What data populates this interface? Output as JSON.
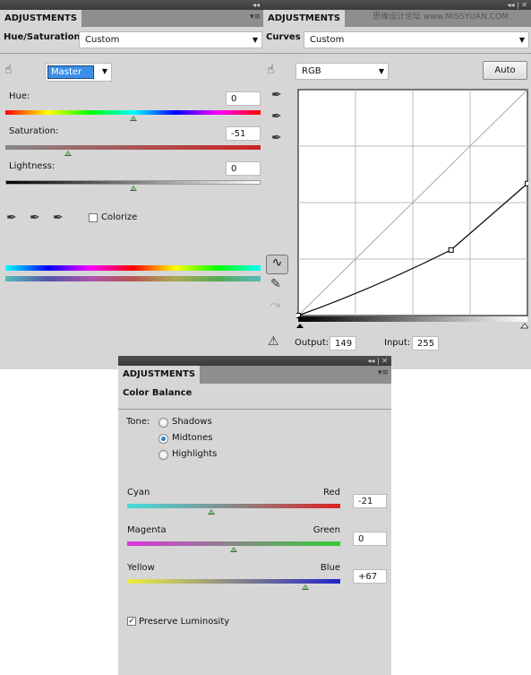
{
  "watermark": "思缘设计论坛 www.MISSYUAN.COM",
  "hue_sat": {
    "tab": "ADJUSTMENTS",
    "title": "Hue/Saturation",
    "preset": "Custom",
    "channel": "Master",
    "hue_label": "Hue:",
    "hue": "0",
    "sat_label": "Saturation:",
    "sat": "-51",
    "light_label": "Lightness:",
    "light": "0",
    "colorize": "Colorize",
    "colorize_checked": false
  },
  "curves": {
    "tab": "ADJUSTMENTS",
    "title": "Curves",
    "preset": "Custom",
    "channel": "RGB",
    "auto": "Auto",
    "output_label": "Output:",
    "output": "149",
    "input_label": "Input:",
    "input": "255",
    "points": [
      [
        0,
        0
      ],
      [
        170,
        74
      ],
      [
        255,
        149
      ]
    ]
  },
  "color_balance": {
    "tab": "ADJUSTMENTS",
    "title": "Color Balance",
    "tone_label": "Tone:",
    "tones": [
      {
        "label": "Shadows",
        "selected": false
      },
      {
        "label": "Midtones",
        "selected": true
      },
      {
        "label": "Highlights",
        "selected": false
      }
    ],
    "sliders": [
      {
        "left": "Cyan",
        "right": "Red",
        "value": "-21"
      },
      {
        "left": "Magenta",
        "right": "Green",
        "value": "0"
      },
      {
        "left": "Yellow",
        "right": "Blue",
        "value": "+67"
      }
    ],
    "preserve": "Preserve Luminosity",
    "preserve_checked": true
  }
}
